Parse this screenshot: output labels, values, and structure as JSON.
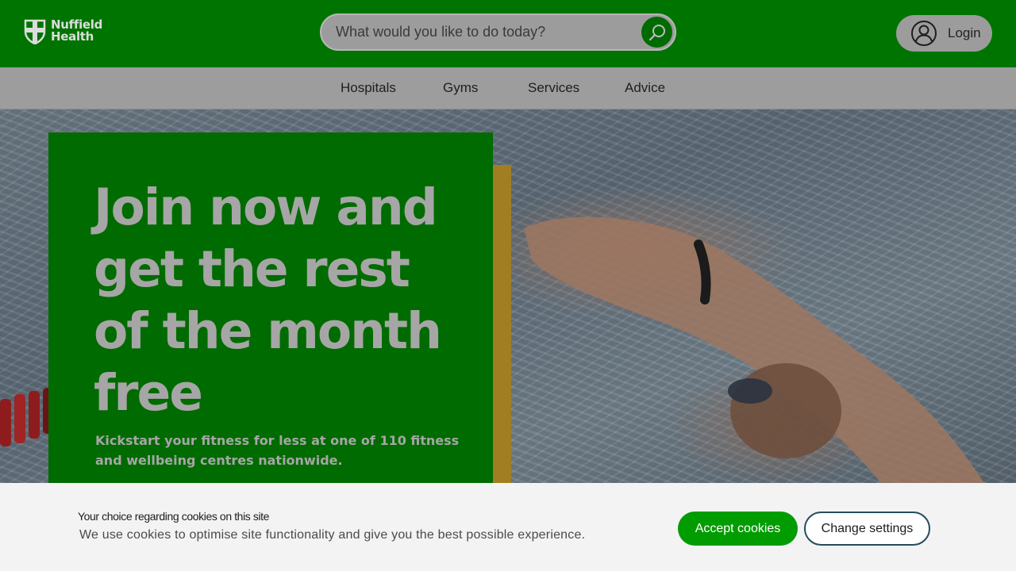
{
  "brand": {
    "name_line1": "Nuffield",
    "name_line2": "Health",
    "logo_icon": "shield-cross-logo"
  },
  "search": {
    "placeholder": "What would you like to do today?",
    "icon": "search-icon"
  },
  "login": {
    "label": "Login",
    "icon": "user-circle-icon"
  },
  "nav": {
    "items": [
      {
        "label": "Hospitals"
      },
      {
        "label": "Gyms"
      },
      {
        "label": "Services"
      },
      {
        "label": "Advice"
      }
    ]
  },
  "hero": {
    "title": "Join now and get the rest of the month free",
    "subtitle": "Kickstart your fitness for less at one of 110 fitness and wellbeing centres nationwide."
  },
  "cookie_banner": {
    "title": "Your choice regarding cookies on this site",
    "text": "We use cookies to optimise site functionality and give you the best possible experience.",
    "accept_label": "Accept cookies",
    "settings_label": "Change settings"
  },
  "colors": {
    "header_green": "#007400",
    "hero_box_green": "#006b00",
    "accent_gold": "#a17e22",
    "accept_green": "#009c00"
  }
}
